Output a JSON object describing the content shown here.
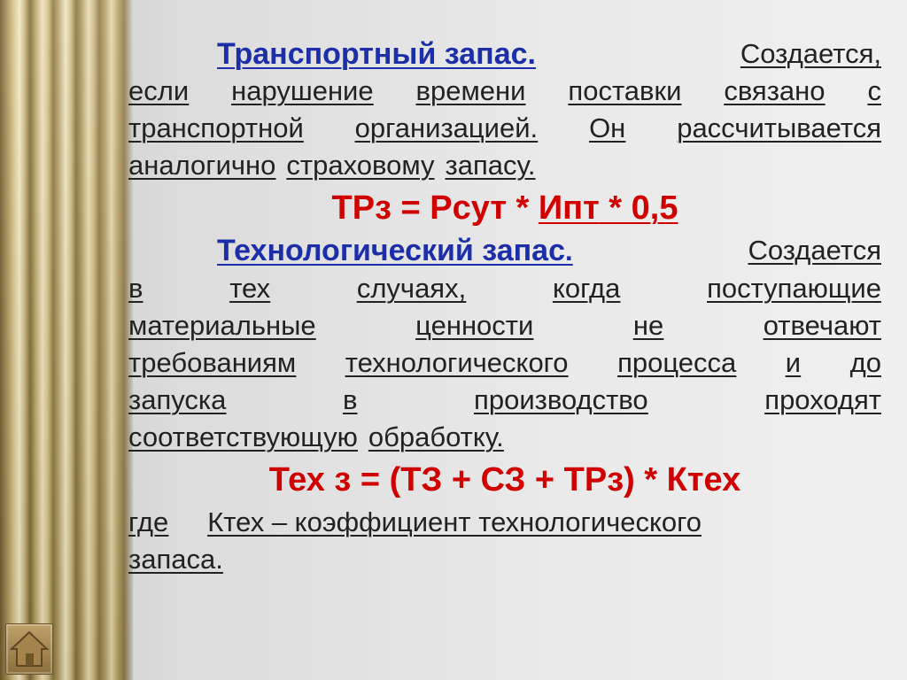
{
  "p1": {
    "term": "Транспортный запас.",
    "lines": [
      [
        "Создается,"
      ],
      [
        "если",
        "нарушение",
        "времени",
        "поставки",
        "связано",
        "с"
      ],
      [
        "транспортной",
        "организацией.",
        "Он",
        "рассчитывается"
      ],
      [
        "аналогично",
        "страховому",
        "запасу."
      ]
    ]
  },
  "formula1": {
    "start": "ТРз = Рсут * ",
    "underlined": "Ипт",
    "end": " * 0,5"
  },
  "p2": {
    "term": "Технологический запас",
    "after_term": ". Создается",
    "lines": [
      [
        "в",
        "тех",
        "случаях,",
        "когда",
        "поступающие"
      ],
      [
        "материальные",
        "ценности",
        "не",
        "отвечают"
      ],
      [
        "требованиям",
        "технологического",
        "процесса",
        "и",
        "до"
      ],
      [
        "запуска",
        "в",
        "производство",
        "проходят"
      ],
      [
        "соответствующую",
        "обработку."
      ]
    ]
  },
  "formula2": "Тех з = (ТЗ + СЗ + ТРз) * Ктех",
  "where": {
    "lines": [
      [
        "где",
        "Ктех – коэффициент технологического"
      ],
      [
        "запаса."
      ]
    ]
  },
  "colors": {
    "term": "#1c2ea8",
    "formula": "#d00000",
    "text": "#222222"
  },
  "icons": {
    "home": "home-icon"
  }
}
